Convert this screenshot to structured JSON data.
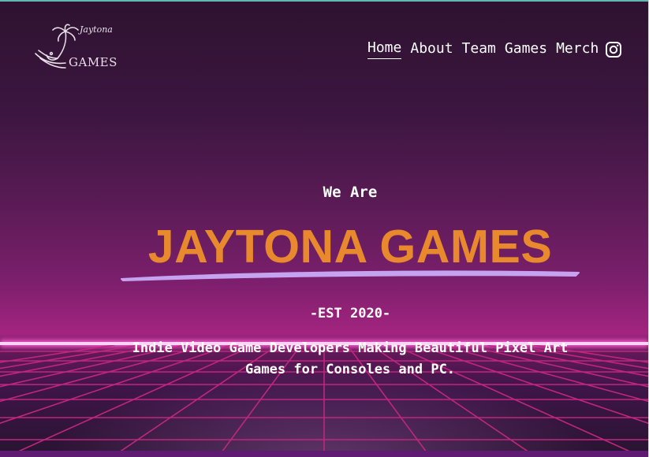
{
  "brand": {
    "logo_script": "Jaytona",
    "logo_word": "GAMES"
  },
  "nav": {
    "items": [
      {
        "label": "Home",
        "active": true
      },
      {
        "label": "About",
        "active": false
      },
      {
        "label": "Team",
        "active": false
      },
      {
        "label": "Games",
        "active": false
      },
      {
        "label": "Merch",
        "active": false
      }
    ],
    "social_icon": "instagram-icon"
  },
  "hero": {
    "pretitle": "We Are",
    "title": "JAYTONA GAMES",
    "established": "-EST 2020-",
    "description": "Indie Video Game Developers Making Beautiful Pixel Art Games for Consoles and PC."
  },
  "colors": {
    "title": "#e8892d",
    "underline": "#c5a3f0",
    "horizon": "#ff5bd0",
    "grid": "#c0267d"
  }
}
